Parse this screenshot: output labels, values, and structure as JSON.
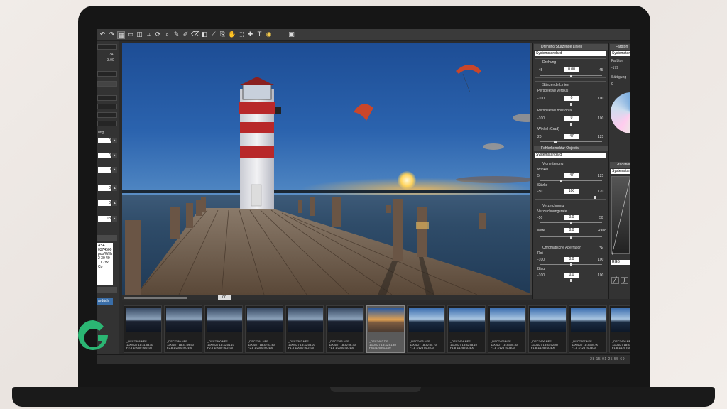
{
  "toolbar": {
    "icons": [
      "undo-icon",
      "redo-icon",
      "grid-view-icon",
      "single-view-icon",
      "compare-icon",
      "crop-icon",
      "rotate-icon",
      "zoom-icon",
      "pen-icon",
      "brush-icon",
      "eraser-icon",
      "gradient-icon",
      "straighten-icon",
      "clone-icon",
      "hand-icon",
      "select-icon",
      "heal-icon",
      "text-icon",
      "color-picker-icon",
      "info-icon"
    ]
  },
  "left_panel": {
    "values": [
      "34",
      "+3.00",
      "0",
      "0",
      "0",
      "0",
      "0",
      "13"
    ],
    "label": "ung",
    "info_lines": [
      "ASF",
      "0374500",
      "poo/Wills",
      "2 30 40",
      "1 LZW Co"
    ],
    "tab": "ardüch"
  },
  "right_panel": {
    "section1": {
      "title": "Drehung/Stürzende Linien",
      "preset": "Systemstandard",
      "rotation": {
        "label": "Drehung",
        "min": "-45",
        "value": "0.00",
        "max": "45",
        "level": 0.5
      },
      "keystone": {
        "label": "Stürzende Linien",
        "vertical": {
          "label": "Perspektive vertikal",
          "min": "-100",
          "value": "0",
          "max": "100",
          "level": 0.5
        },
        "horizontal": {
          "label": "Perspektive horizontal",
          "min": "-100",
          "value": "0",
          "max": "100",
          "level": 0.5
        },
        "angle": {
          "label": "Winkel (Grad)",
          "min": "20",
          "value": "47",
          "max": "125",
          "level": 0.26
        }
      }
    },
    "section2": {
      "title": "Fehlerkorrektur Objektiv",
      "preset": "Systemstandard",
      "vignette": {
        "label": "Vignettierung",
        "angle": {
          "label": "Winkel",
          "min": "5",
          "value": "47",
          "max": "125",
          "level": 0.35
        },
        "strength": {
          "label": "Stärke",
          "min": "-50",
          "value": "100",
          "max": "120",
          "level": 0.88
        }
      },
      "distortion": {
        "label": "Verzeichnung",
        "amount": {
          "label": "Verzeichnungsrate",
          "min": "-50",
          "value": "0.0",
          "max": "50",
          "level": 0.5
        },
        "center": {
          "label": "Mitte",
          "min": "",
          "value": "0.0",
          "max": "Rand",
          "level": 0.5
        }
      },
      "chromatic": {
        "label": "Chromatische Aberration",
        "red": {
          "label": "Rot",
          "min": "-100",
          "value": "0.0",
          "max": "100",
          "level": 0.5
        },
        "blue": {
          "label": "Blau",
          "min": "-100",
          "value": "0.0",
          "max": "100",
          "level": 0.5
        }
      }
    }
  },
  "far_right_panel": {
    "title": "Farbton",
    "preset": "Systemstand",
    "hue_label": "Farbton",
    "hue_value": "-179",
    "sat_label": "Sättigung",
    "sat_value": "0",
    "section2_title": "Gradation",
    "section2_preset": "Systemstand",
    "channel": "RGB"
  },
  "filmstrip": {
    "thumbs": [
      {
        "caption": "_DSC7388.NEF\n12/04/27 18:31:58.80\nF2.8 1/2000 ISO100",
        "style": "dusk"
      },
      {
        "caption": "_DSC7389.NEF\n12/04/27 18:31:59.50\nF2.8 1/2000 ISO100",
        "style": "dusk"
      },
      {
        "caption": "_DSC7390.NEF\n12/04/27 18:32:01.10\nF2.8 1/2000 ISO100",
        "style": "dusk"
      },
      {
        "caption": "_DSC7391.NEF\n12/04/27 18:32:03.40\nF2.8 1/2000 ISO100",
        "style": "dusk"
      },
      {
        "caption": "_DSC7392.NEF\n12/04/27 18:32:05.20\nF1.8 1/2000 ISO100",
        "style": "dusk"
      },
      {
        "caption": "_DSC7393.NEF\n12/04/27 18:32:06.30\nF1.8 1/2000 ISO100",
        "style": "dusk"
      },
      {
        "caption": "_DSC7402.TIF\n12/04/27 18:32:51.40\nF8 1/125 ISO100",
        "style": "sunset",
        "selected": true
      },
      {
        "caption": "_DSC7403.NEF\n12/04/27 18:32:55.70\nF1.8 1/125 ISO400",
        "style": "blue"
      },
      {
        "caption": "_DSC7404.NEF\n12/04/27 18:32:58.10\nF1.8 1/125 ISO400",
        "style": "blue"
      },
      {
        "caption": "_DSC7405.NEF\n12/04/27 18:33:00.30\nF1.8 1/125 ISO400",
        "style": "blue"
      },
      {
        "caption": "_DSC7406.NEF\n12/04/27 18:33:02.80\nF1.8 1/125 ISO400",
        "style": "blue"
      },
      {
        "caption": "_DSC7407.NEF\n12/04/27 18:33:04.90\nF1.8 1/125 ISO400",
        "style": "blue"
      },
      {
        "caption": "_DSC7408.NEF\n12/04/27 18:33:07.20\nF1.8 1/125 ISO400",
        "style": "blue"
      }
    ]
  },
  "statusbar": {
    "text": "28 15 01 25 55 69"
  },
  "image_scroll": {
    "zoom_value": "00"
  },
  "colors": {
    "accent_yellow": "#f2c94c",
    "lighthouse_red": "#b8282a",
    "kite_orange": "#c9462a"
  }
}
